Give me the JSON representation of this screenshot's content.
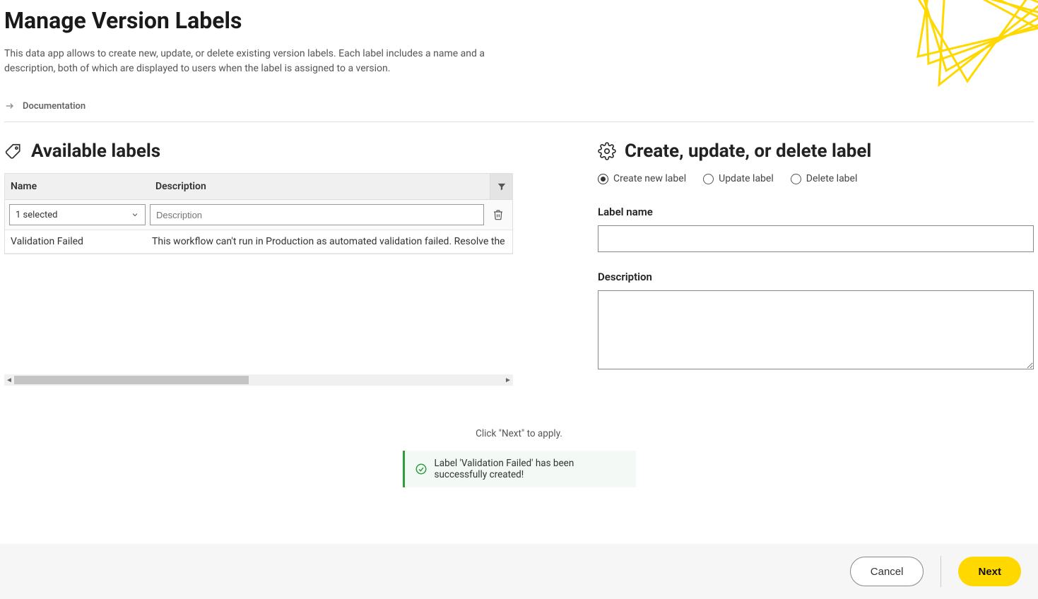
{
  "header": {
    "title": "Manage Version Labels",
    "description": "This data app allows to create new, update, or delete existing version labels. Each label includes a name and a description, both of which are displayed to users when the label is assigned to a version.",
    "doc_link": "Documentation"
  },
  "available": {
    "heading": "Available labels",
    "columns": {
      "name": "Name",
      "description": "Description"
    },
    "filter": {
      "selected_text": "1 selected",
      "description_placeholder": "Description"
    },
    "rows": [
      {
        "name": "Validation Failed",
        "description": "This workflow can't run in Production as automated validation failed. Resolve the issue"
      }
    ]
  },
  "form": {
    "heading": "Create, update, or delete label",
    "radios": {
      "create": "Create new label",
      "update": "Update label",
      "delete": "Delete label",
      "selected": "create"
    },
    "label_name_label": "Label name",
    "label_name_value": "",
    "description_label": "Description",
    "description_value": ""
  },
  "apply_hint": "Click \"Next\" to apply.",
  "success_message": "Label 'Validation Failed' has been successfully created!",
  "footer": {
    "cancel": "Cancel",
    "next": "Next"
  }
}
